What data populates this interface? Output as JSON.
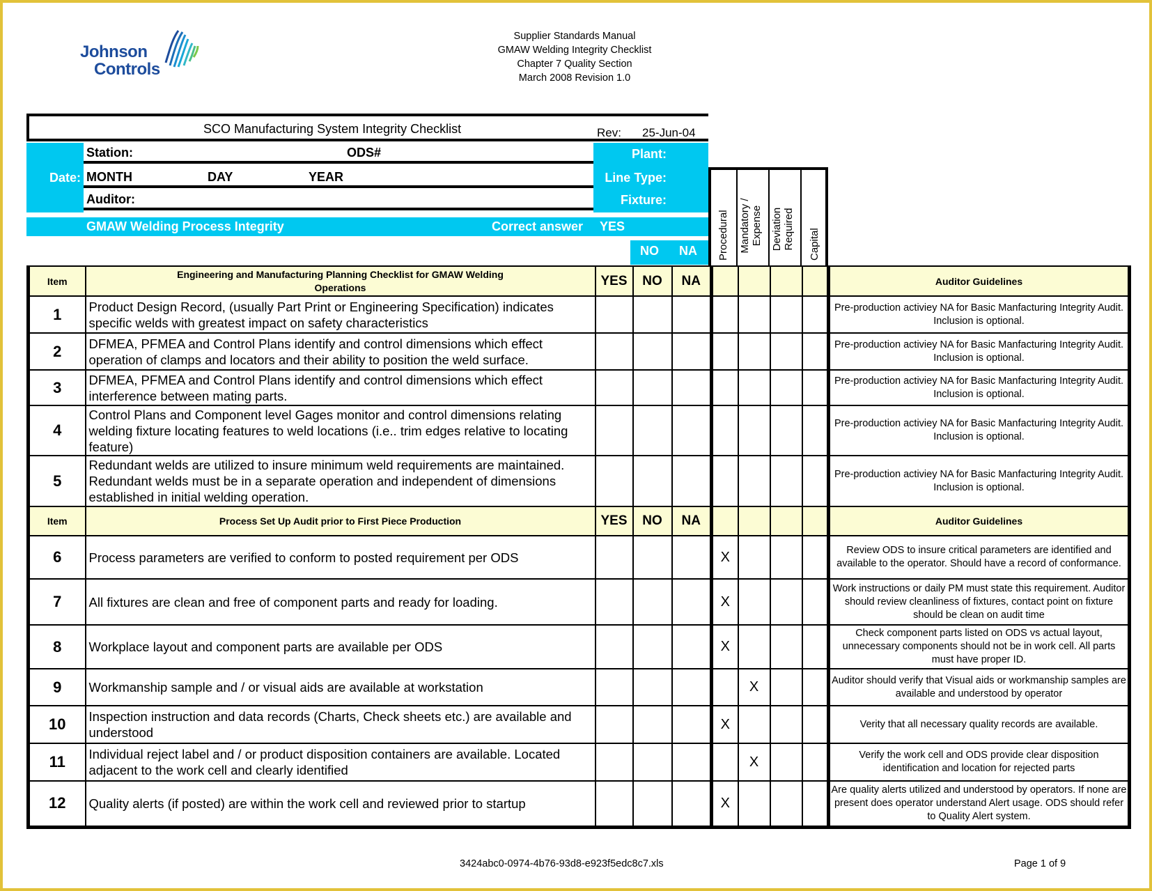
{
  "logo": {
    "line1": "Johnson",
    "line2": "Controls"
  },
  "doc_header": [
    "Supplier Standards Manual",
    "GMAW Welding Integrity Checklist",
    "Chapter 7 Quality Section",
    "March 2008 Revision 1.0"
  ],
  "form": {
    "title": "SCO Manufacturing System Integrity Checklist",
    "rev_label": "Rev:",
    "rev_value": "25-Jun-04",
    "date_label": "Date:",
    "station_label": "Station:",
    "ods_label": "ODS#",
    "month_label": "MONTH",
    "day_label": "DAY",
    "year_label": "YEAR",
    "auditor_label": "Auditor:",
    "plant_label": "Plant:",
    "line_type_label": "Line Type:",
    "fixture_label": "Fixture:",
    "section_label": "GMAW Welding Process Integrity",
    "correct_answer_label": "Correct answer",
    "yes_label": "YES",
    "no_label": "NO",
    "na_label": "NA"
  },
  "category_headers": [
    "Procedural",
    "Mandatory / Expense",
    "Deviation Required",
    "Capital"
  ],
  "sections": [
    {
      "item_label": "Item",
      "title": "Engineering and Manufacturing Planning Checklist for GMAW Welding Operations",
      "yes": "YES",
      "no": "NO",
      "na": "NA",
      "guidelines_label": "Auditor Guidelines",
      "rows": [
        {
          "num": "1",
          "text": "Product Design Record, (usually Part Print or Engineering Specification) indicates specific welds with greatest impact on safety characteristics",
          "marks": [
            "",
            "",
            "",
            ""
          ],
          "guideline": "Pre-production activiey NA for Basic Manfacturing Integrity Audit. Inclusion is optional."
        },
        {
          "num": "2",
          "text": "DFMEA, PFMEA and Control Plans identify and control dimensions which effect operation of clamps and locators and their ability to position the weld surface.",
          "marks": [
            "",
            "",
            "",
            ""
          ],
          "guideline": "Pre-production activiey NA for Basic Manfacturing Integrity Audit. Inclusion is optional."
        },
        {
          "num": "3",
          "text": "DFMEA, PFMEA and Control Plans identify and control dimensions which effect interference between mating parts.",
          "marks": [
            "",
            "",
            "",
            ""
          ],
          "guideline": "Pre-production activiey NA for Basic Manfacturing Integrity Audit. Inclusion is optional."
        },
        {
          "num": "4",
          "text": "Control Plans and Component level Gages monitor and control dimensions relating welding fixture locating features  to weld locations (i.e.. trim edges relative to locating feature)",
          "marks": [
            "",
            "",
            "",
            ""
          ],
          "guideline": "Pre-production activiey NA for Basic Manfacturing Integrity Audit. Inclusion is optional."
        },
        {
          "num": "5",
          "text": "Redundant welds are utilized to insure minimum weld requirements are maintained. Redundant welds must be in a separate operation and independent of dimensions established in initial welding operation.",
          "marks": [
            "",
            "",
            "",
            ""
          ],
          "guideline": "Pre-production activiey NA for Basic Manfacturing Integrity Audit. Inclusion is optional."
        }
      ]
    },
    {
      "item_label": "Item",
      "title": "Process Set Up Audit prior to First Piece Production",
      "yes": "YES",
      "no": "NO",
      "na": "NA",
      "guidelines_label": "Auditor Guidelines",
      "rows": [
        {
          "num": "6",
          "text": "Process parameters are verified to conform to posted requirement per ODS",
          "marks": [
            "X",
            "",
            "",
            ""
          ],
          "guideline": "Review ODS to insure critical parameters are identified and available to the operator. Should have a record of conformance."
        },
        {
          "num": "7",
          "text": "All fixtures are clean and free of component parts and ready for loading.",
          "marks": [
            "X",
            "",
            "",
            ""
          ],
          "guideline": "Work instructions or daily PM must state this requirement. Auditor should review cleanliness of fixtures, contact point on fixture should be clean on audit time"
        },
        {
          "num": "8",
          "text": "Workplace layout and component parts are available per ODS",
          "marks": [
            "X",
            "",
            "",
            ""
          ],
          "guideline": "Check component parts listed on ODS vs actual layout, unnecessary components should not be in work cell. All parts must have proper ID."
        },
        {
          "num": "9",
          "text": "Workmanship sample and / or visual aids are available at workstation",
          "marks": [
            "",
            "X",
            "",
            ""
          ],
          "guideline": "Auditor should verify that Visual aids or workmanship samples are available and understood by operator"
        },
        {
          "num": "10",
          "text": "Inspection instruction and data records (Charts, Check sheets etc.) are available and understood",
          "marks": [
            "X",
            "",
            "",
            ""
          ],
          "guideline": "Verity that all necessary quality records are available."
        },
        {
          "num": "11",
          "text": "Individual reject label and / or product disposition containers are available. Located adjacent to the work cell and clearly identified",
          "marks": [
            "",
            "X",
            "",
            ""
          ],
          "guideline": "Verify the work cell and ODS provide clear disposition identification and location for rejected parts"
        },
        {
          "num": "12",
          "text": "Quality alerts (if posted) are within the work cell and reviewed prior to startup",
          "marks": [
            "X",
            "",
            "",
            ""
          ],
          "guideline": "Are quality alerts utilized and understood by operators. If none are present does operator understand Alert usage. ODS should refer to Quality Alert system."
        }
      ]
    }
  ],
  "footer": {
    "file_name": "3424abc0-0974-4b76-93d8-e923f5edc8c7.xls",
    "page": "Page 1 of 9"
  },
  "colors": {
    "accent_cyan": "#00c8f0",
    "header_fill": "#fcfcd4",
    "logo_blue": "#1d4c9c",
    "frame_gold": "#e2c23a"
  }
}
